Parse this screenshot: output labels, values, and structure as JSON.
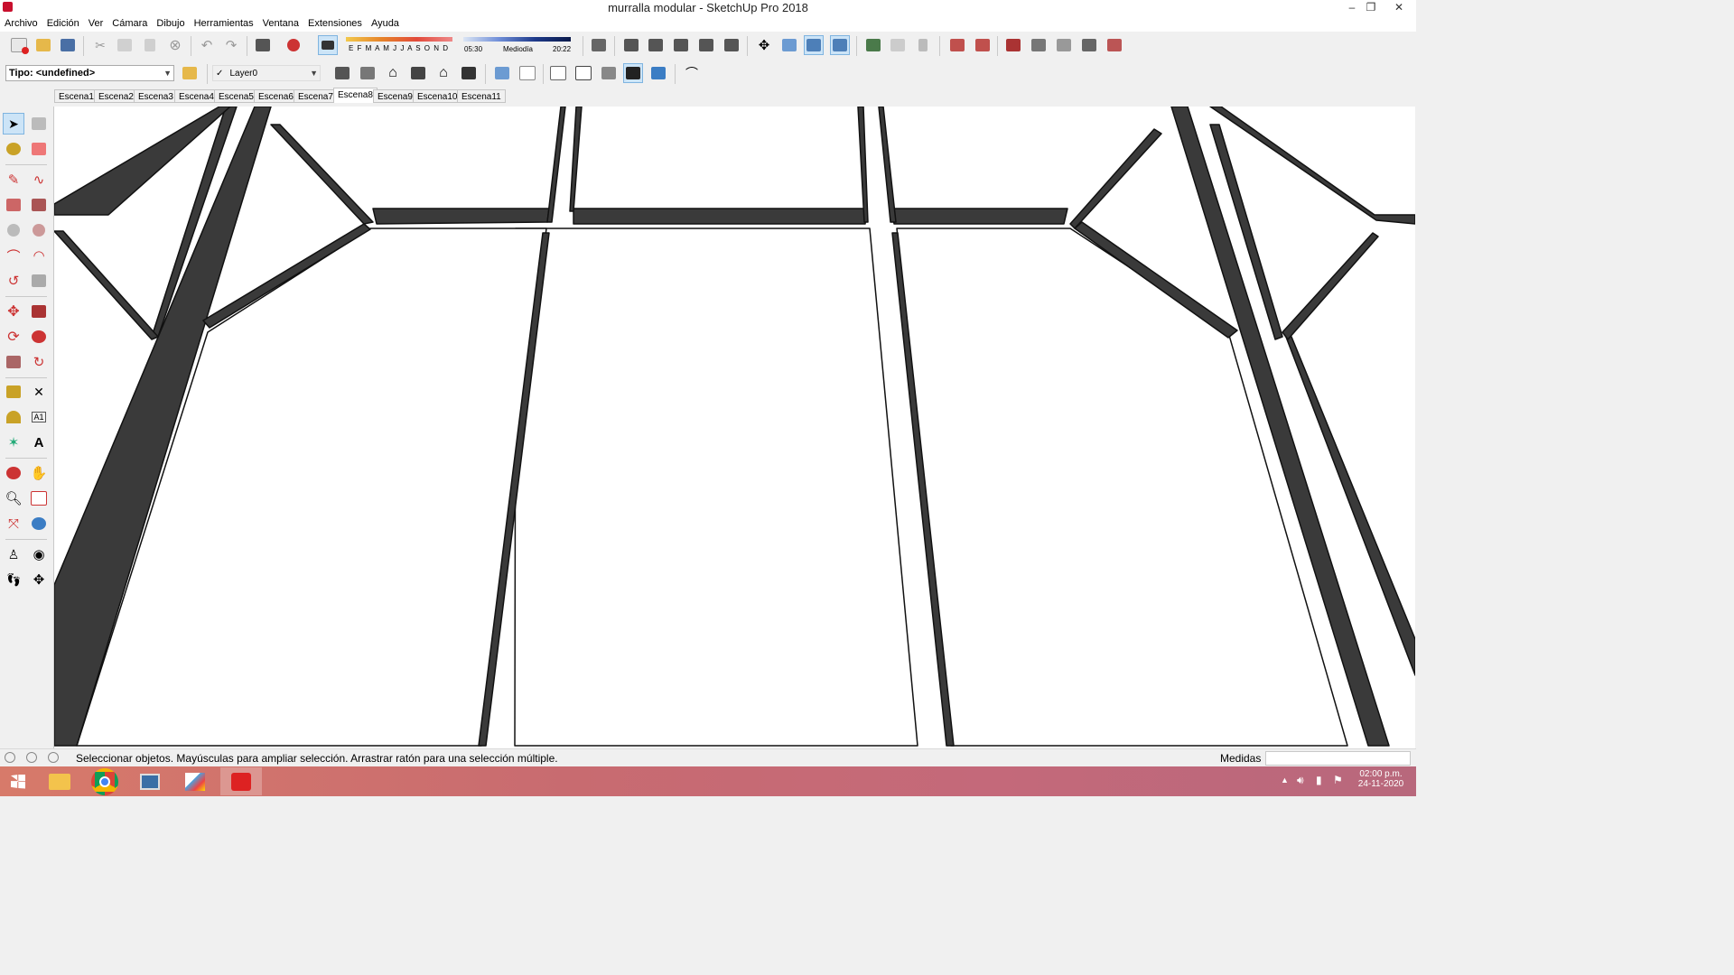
{
  "window": {
    "title": "murralla modular - SketchUp Pro 2018",
    "controls": {
      "minimize": "–",
      "restore": "❐",
      "close": "✕"
    }
  },
  "menu": [
    "Archivo",
    "Edición",
    "Ver",
    "Cámara",
    "Dibujo",
    "Herramientas",
    "Ventana",
    "Extensiones",
    "Ayuda"
  ],
  "shadow": {
    "months": "E F M A M J J A S O N D",
    "time_start": "05:30",
    "time_mid": "Mediodía",
    "time_end": "20:22"
  },
  "type_select": {
    "value": "Tipo: <undefined>"
  },
  "layer_select": {
    "check": "✓",
    "value": "Layer0"
  },
  "scenes": [
    "Escena1",
    "Escena2",
    "Escena3",
    "Escena4",
    "Escena5",
    "Escena6",
    "Escena7",
    "Escena8",
    "Escena9",
    "Escena10",
    "Escena11"
  ],
  "active_scene": "Escena8",
  "status": {
    "message": "Seleccionar objetos. Mayúsculas para ampliar selección. Arrastrar ratón para una selección múltiple.",
    "measure_label": "Medidas",
    "measure_value": ""
  },
  "taskbar": {
    "time": "02:00 p.m.",
    "date": "24-11-2020"
  },
  "colors": {
    "selection_blue": "#cce4f7",
    "panel": "#f0f0f0",
    "model_dark": "#3a3a3a",
    "model_light": "#ffffff"
  }
}
